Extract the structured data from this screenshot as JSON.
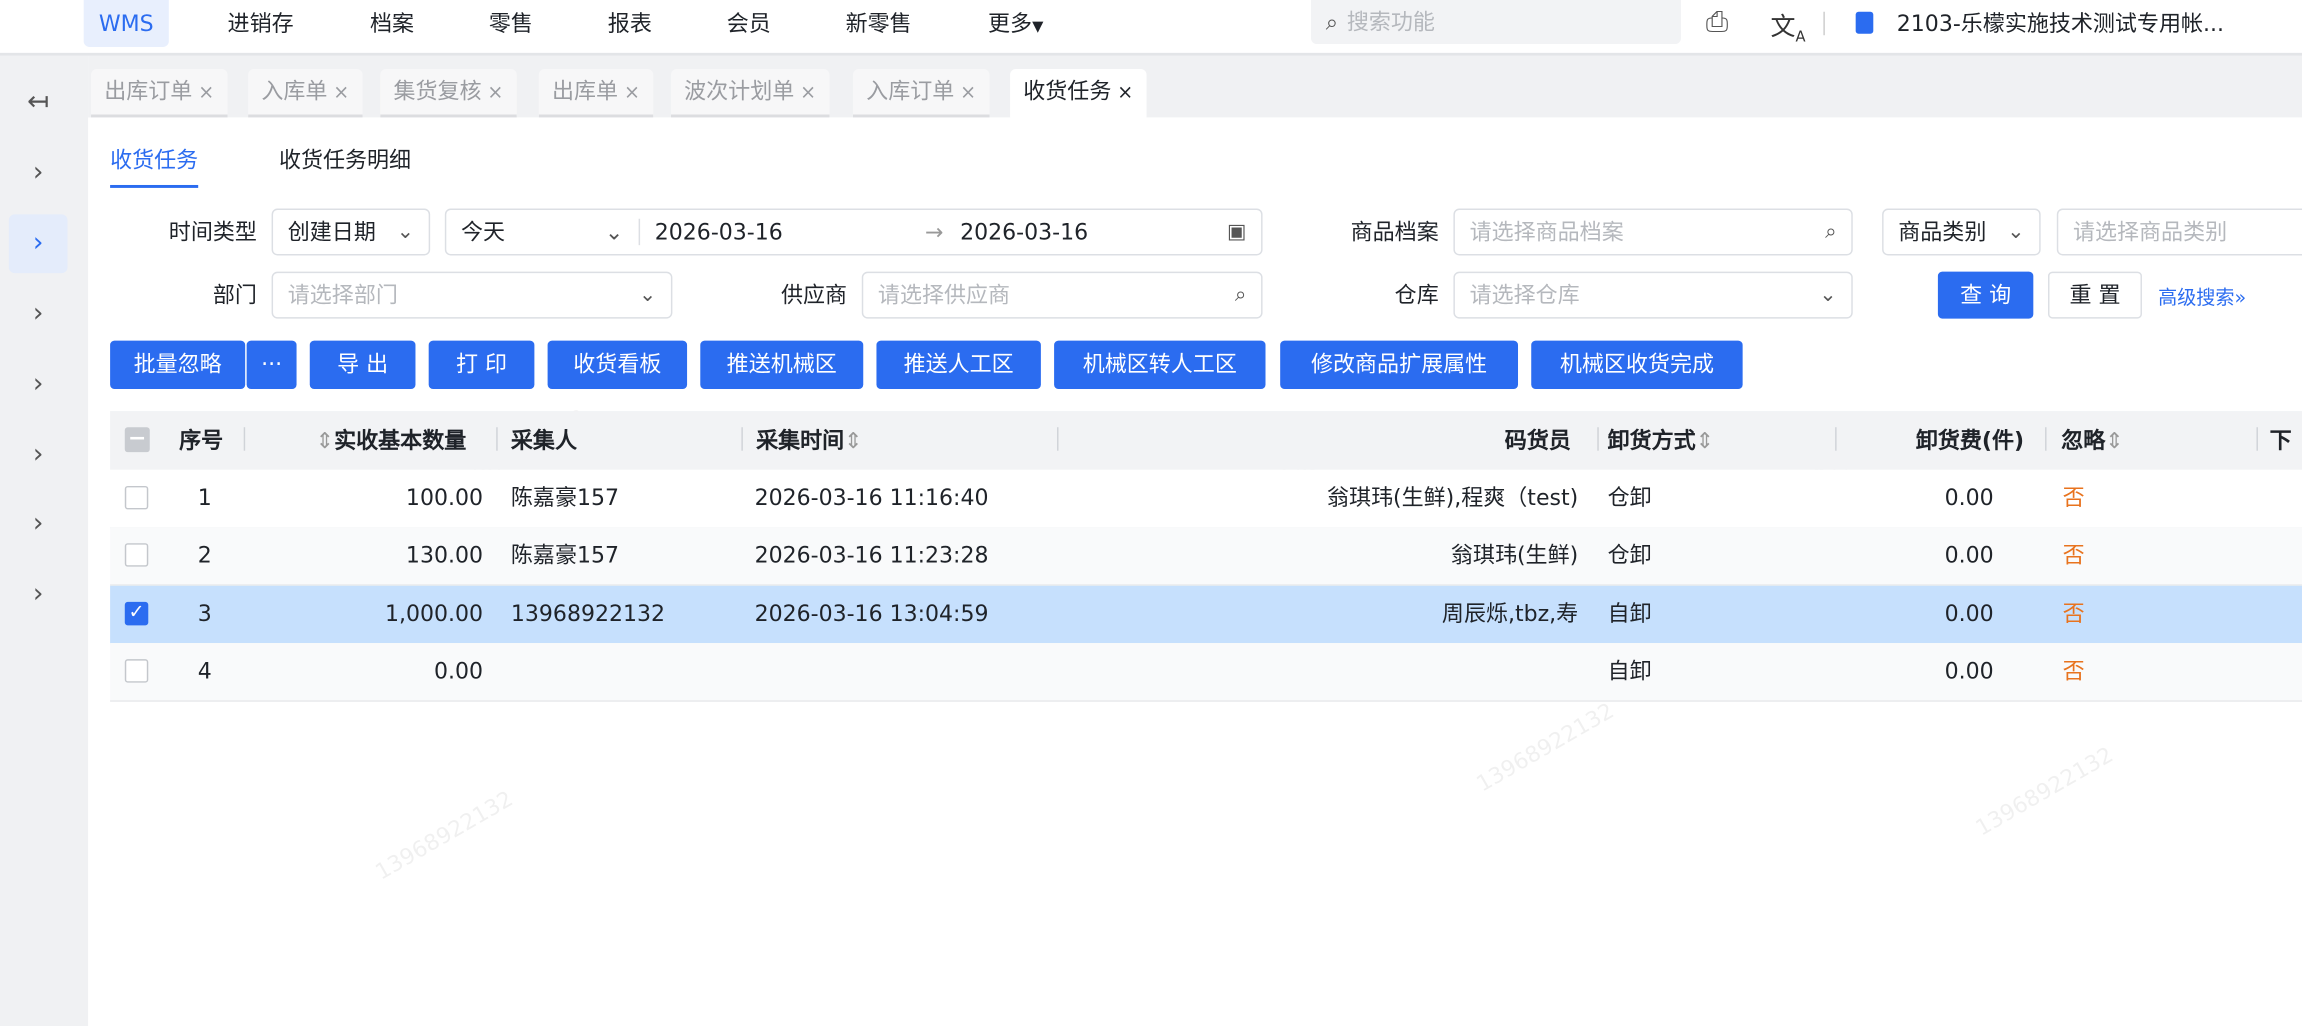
{
  "topnav": {
    "items": [
      "WMS",
      "进销存",
      "档案",
      "零售",
      "报表",
      "会员",
      "新零售",
      "更多"
    ],
    "search_placeholder": "搜索功能",
    "account": "2103-乐檬实施技术测试专用帐..."
  },
  "tabs": [
    {
      "label": "出库订单"
    },
    {
      "label": "入库单"
    },
    {
      "label": "集货复核"
    },
    {
      "label": "出库单"
    },
    {
      "label": "波次计划单"
    },
    {
      "label": "入库订单"
    },
    {
      "label": "收货任务"
    }
  ],
  "tab_close": "×",
  "subtabs": [
    "收货任务",
    "收货任务明细"
  ],
  "filters": {
    "time_type_label": "时间类型",
    "time_type_value": "创建日期",
    "range_preset": "今天",
    "date_start": "2026-03-16",
    "date_end": "2026-03-16",
    "product_label": "商品档案",
    "product_placeholder": "请选择商品档案",
    "category_select": "商品类别",
    "category_placeholder": "请选择商品类别",
    "dept_label": "部门",
    "dept_placeholder": "请选择部门",
    "supplier_label": "供应商",
    "supplier_placeholder": "请选择供应商",
    "warehouse_label": "仓库",
    "warehouse_placeholder": "请选择仓库",
    "query": "查 询",
    "reset": "重 置",
    "advanced": "高级搜索"
  },
  "actions": [
    "批量忽略",
    "导 出",
    "打 印",
    "收货看板",
    "推送机械区",
    "推送人工区",
    "机械区转人工区",
    "修改商品扩展属性",
    "机械区收货完成"
  ],
  "more_label": "···",
  "table": {
    "headers": [
      "序号",
      "实收基本数量",
      "采集人",
      "采集时间",
      "码货员",
      "卸货方式",
      "卸货费(件)",
      "忽略",
      "下"
    ],
    "rows": [
      {
        "no": "1",
        "qty": "100.00",
        "collector": "陈嘉豪157",
        "time": "2026-03-16 11:16:40",
        "stacker": "翁琪玮(生鲜),程爽（test)",
        "unload": "仓卸",
        "fee": "0.00",
        "ignore": "否",
        "checked": false
      },
      {
        "no": "2",
        "qty": "130.00",
        "collector": "陈嘉豪157",
        "time": "2026-03-16 11:23:28",
        "stacker": "翁琪玮(生鲜)",
        "unload": "仓卸",
        "fee": "0.00",
        "ignore": "否",
        "checked": false
      },
      {
        "no": "3",
        "qty": "1,000.00",
        "collector": "13968922132",
        "time": "2026-03-16 13:04:59",
        "stacker": "周辰烁,tbz,寿",
        "unload": "自卸",
        "fee": "0.00",
        "ignore": "否",
        "checked": true
      },
      {
        "no": "4",
        "qty": "0.00",
        "collector": "",
        "time": "",
        "stacker": "",
        "unload": "自卸",
        "fee": "0.00",
        "ignore": "否",
        "checked": false
      }
    ]
  },
  "colors": {
    "primary": "#2b6cf0",
    "selected_row": "#c6e0fd",
    "orange": "#e8731e"
  }
}
